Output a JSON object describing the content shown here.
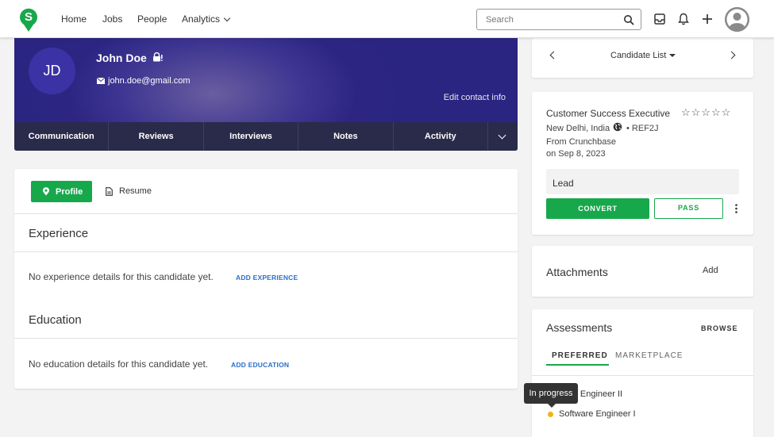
{
  "nav": {
    "home": "Home",
    "jobs": "Jobs",
    "people": "People",
    "analytics": "Analytics",
    "search_placeholder": "Search"
  },
  "candidate": {
    "initials": "JD",
    "name": "John Doe",
    "email": "john.doe@gmail.com",
    "edit_contact": "Edit contact info"
  },
  "tabs": [
    "Communication",
    "Reviews",
    "Interviews",
    "Notes",
    "Activity"
  ],
  "main": {
    "profile_label": "Profile",
    "resume_label": "Resume",
    "experience_title": "Experience",
    "experience_empty": "No experience details for this candidate yet.",
    "add_experience": "ADD EXPERIENCE",
    "education_title": "Education",
    "education_empty": "No education details for this candidate yet.",
    "add_education": "ADD EDUCATION"
  },
  "candidate_list": {
    "label": "Candidate List"
  },
  "job": {
    "title": "Customer Success Executive",
    "stars": "☆☆☆☆☆",
    "rating": 0,
    "location": "New Delhi, India",
    "ref": "• REF2J",
    "source": "From Crunchbase",
    "date": "on Sep 8, 2023",
    "stage": "Lead",
    "convert": "CONVERT",
    "pass": "PASS"
  },
  "attachments": {
    "title": "Attachments",
    "add": "Add"
  },
  "assessments": {
    "title": "Assessments",
    "browse": "BROWSE",
    "tab_preferred": "PREFERRED",
    "tab_marketplace": "MARKETPLACE",
    "items": [
      "ware Engineer II",
      "Software Engineer I"
    ],
    "tooltip": "In progress"
  },
  "colors": {
    "brand": "#18a84c",
    "hero": "#2c2682",
    "tabs_bg": "#2a2a4a",
    "link": "#2a6fc9",
    "status_dot": "#f2b21b"
  }
}
